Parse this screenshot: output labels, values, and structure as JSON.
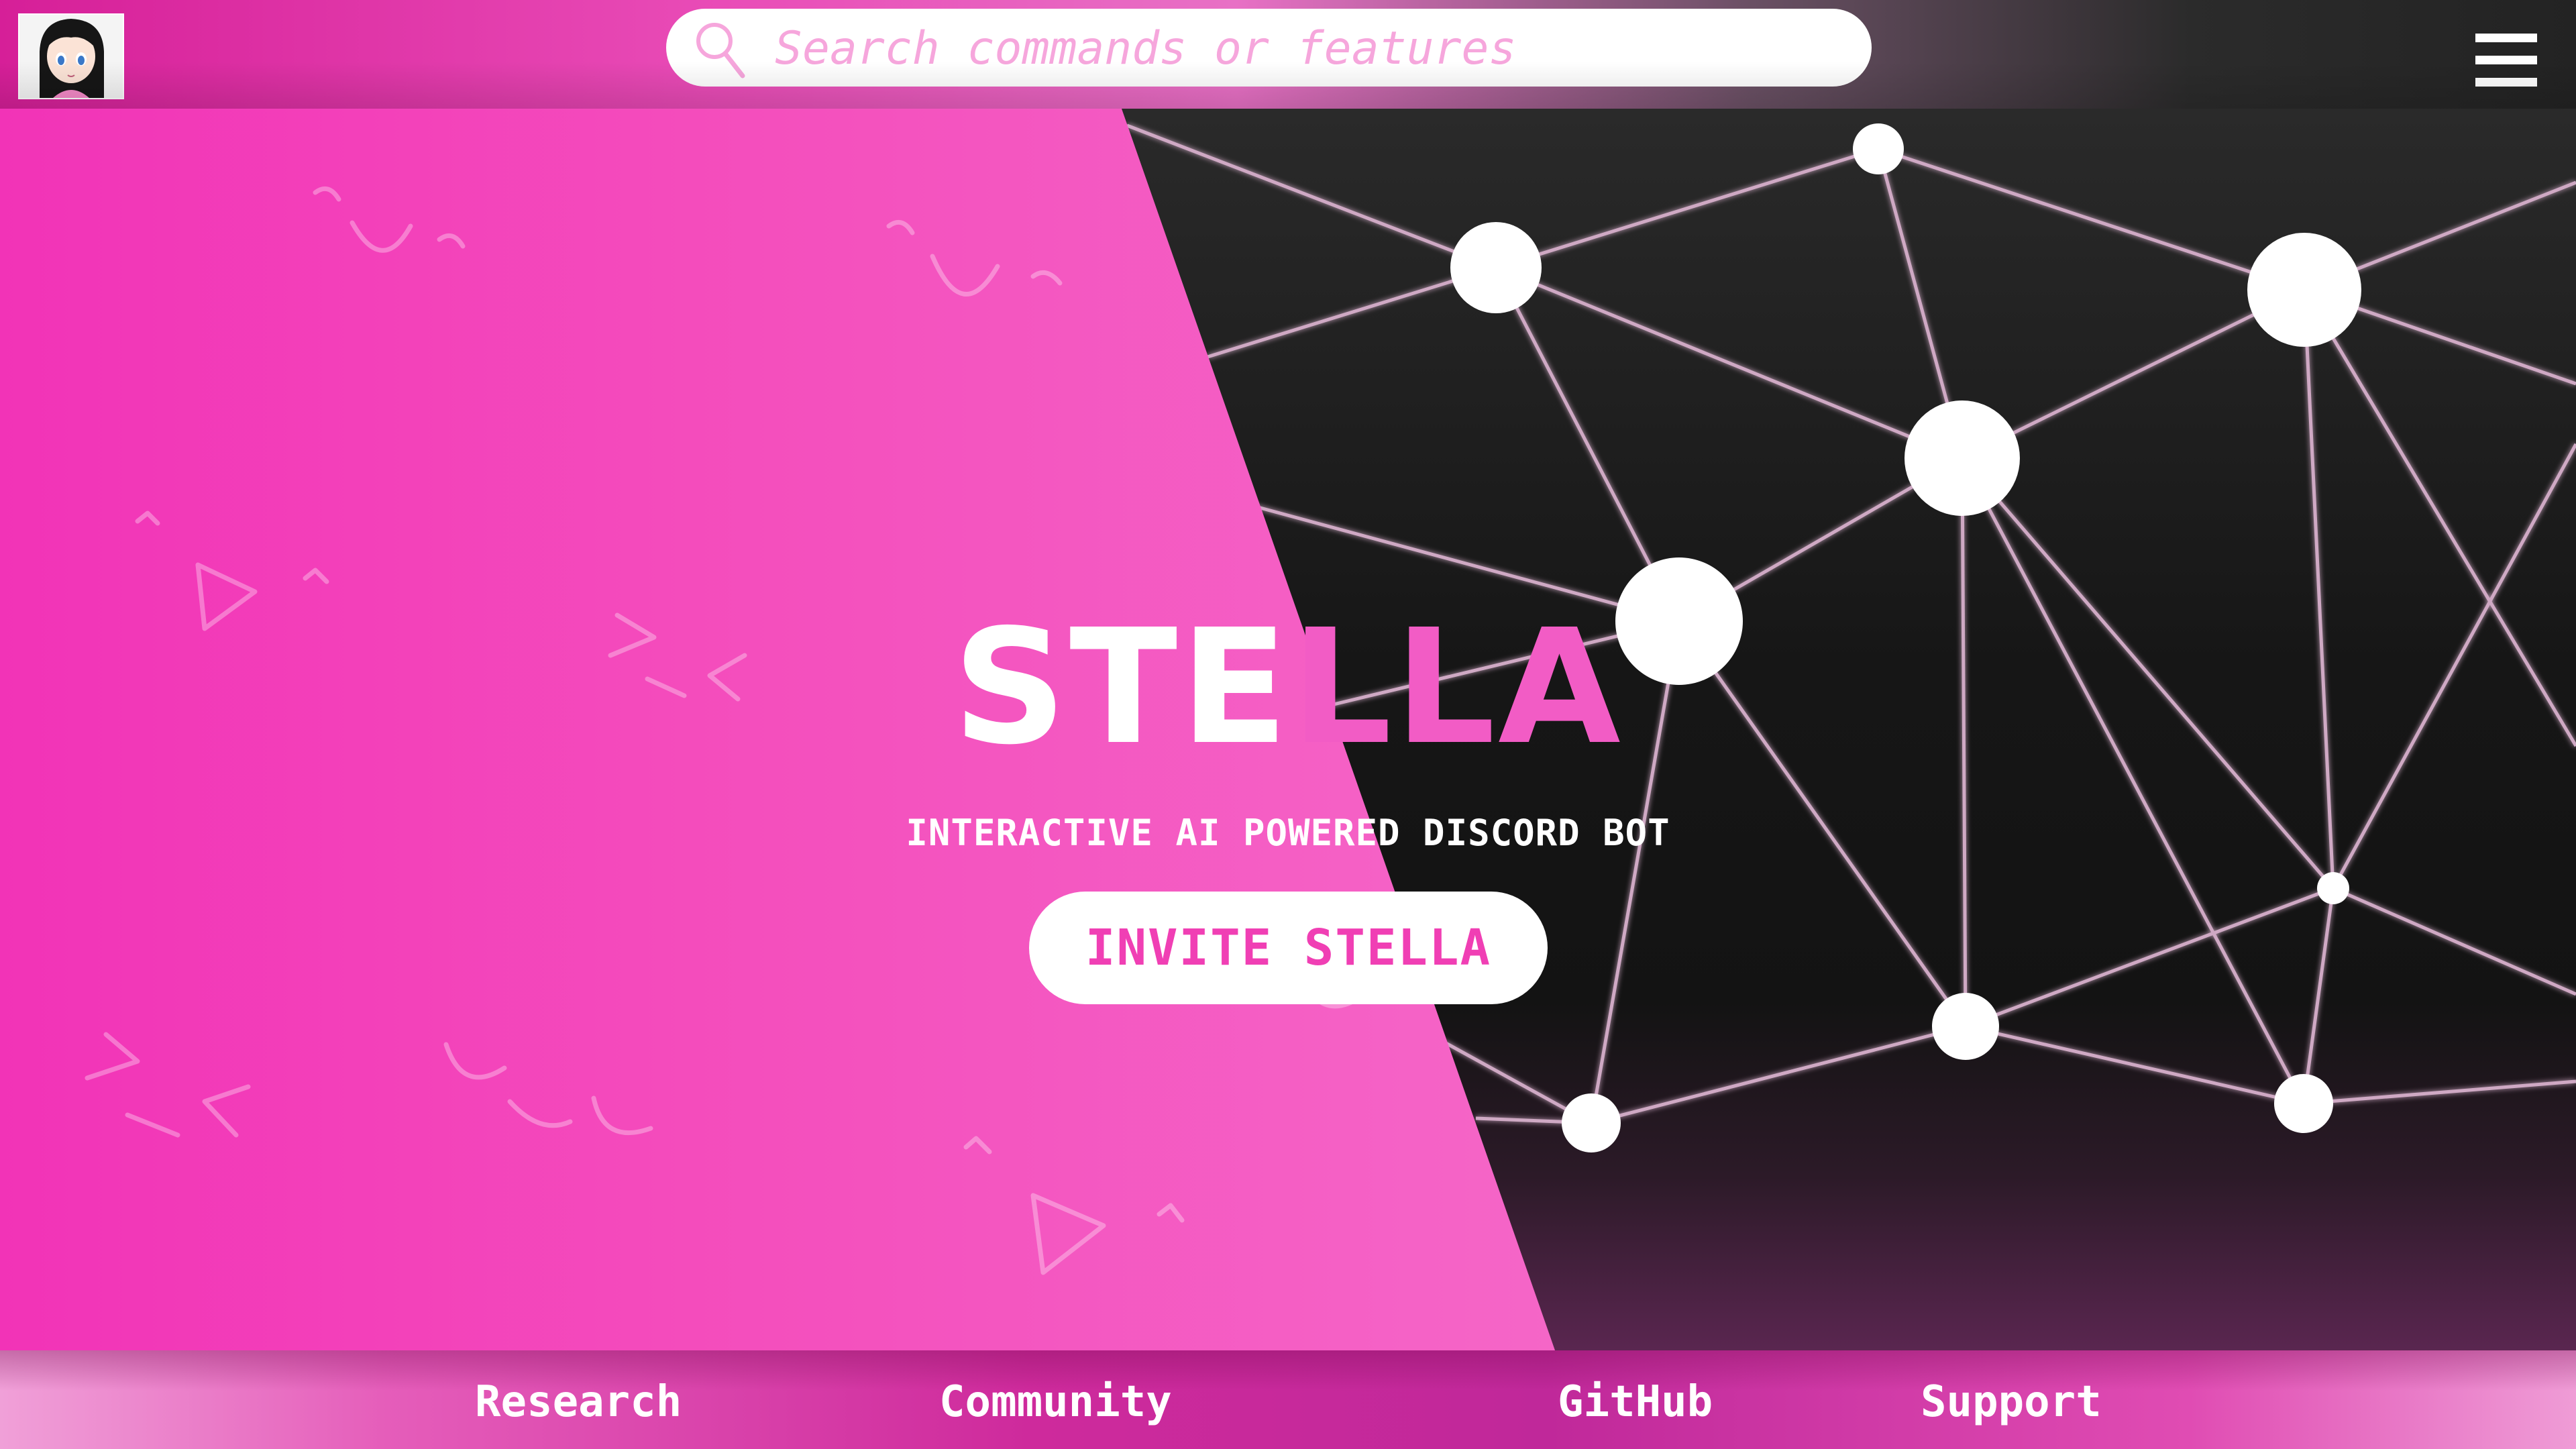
{
  "header": {
    "search": {
      "placeholder": "Search commands or features",
      "value": ""
    },
    "avatar_icon": "anime-girl-avatar-icon",
    "search_icon": "search-icon",
    "menu_icon": "hamburger-menu-icon"
  },
  "hero": {
    "title": "STELLA",
    "subtitle": "INTERACTIVE AI POWERED DISCORD BOT",
    "invite_label": "INVITE STELLA"
  },
  "footer": {
    "links": [
      "Research",
      "Community",
      "GitHub",
      "Support"
    ]
  },
  "colors": {
    "accent_pink": "#f23fb4",
    "dark_background": "#161616",
    "text_white": "#ffffff"
  }
}
